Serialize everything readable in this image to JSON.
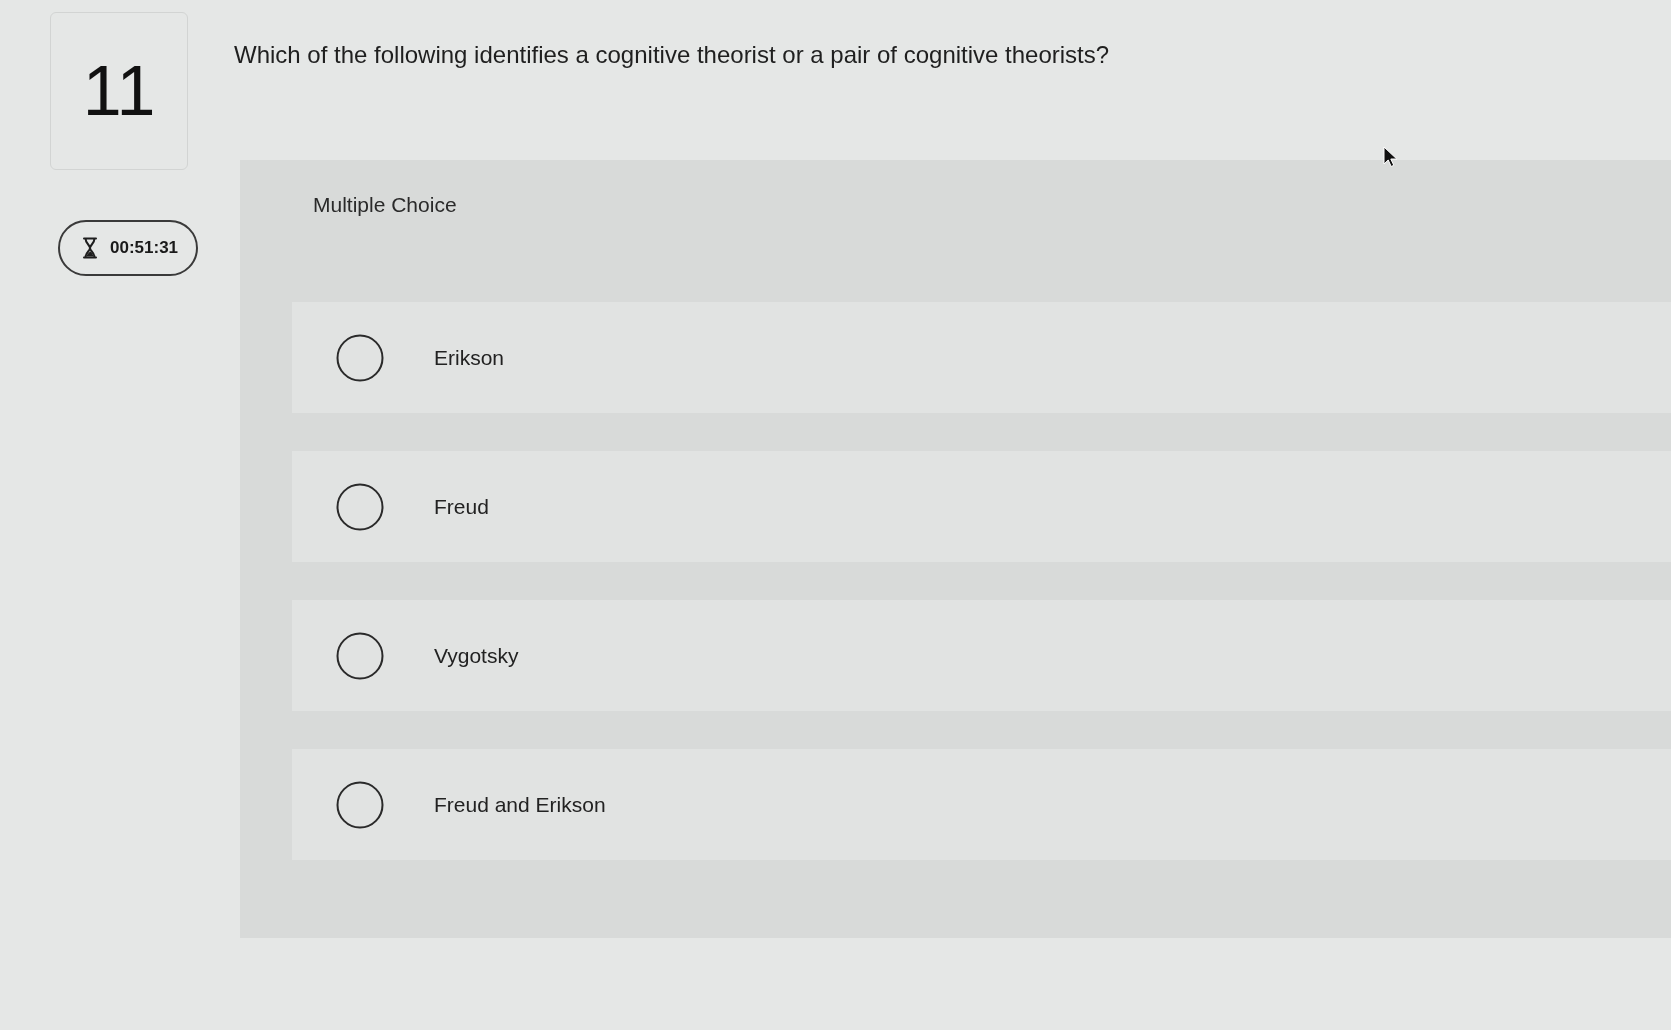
{
  "question": {
    "number": "11",
    "text": "Which of the following identifies a cognitive theorist or a pair of cognitive theorists?"
  },
  "timer": {
    "time": "00:51:31"
  },
  "answer_area": {
    "type_label": "Multiple Choice",
    "options": [
      {
        "label": "Erikson",
        "selected": false
      },
      {
        "label": "Freud",
        "selected": false
      },
      {
        "label": "Vygotsky",
        "selected": false
      },
      {
        "label": "Freud and Erikson",
        "selected": false
      }
    ]
  }
}
